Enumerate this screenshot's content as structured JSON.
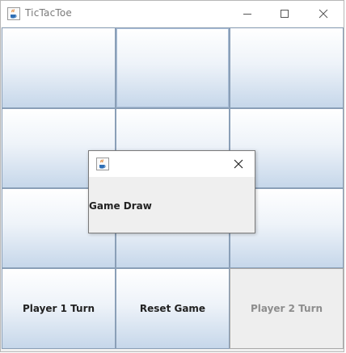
{
  "window": {
    "title": "TicTacToe",
    "icon": "java-cup-icon",
    "controls": [
      "minimize-icon",
      "maximize-icon",
      "close-icon"
    ]
  },
  "board": {
    "cells": [
      "",
      "",
      "",
      "",
      "",
      "",
      "",
      "",
      ""
    ]
  },
  "bottom_bar": {
    "player1": "Player 1 Turn",
    "reset": "Reset Game",
    "player2": "Player 2 Turn"
  },
  "dialog": {
    "title": "",
    "icon": "java-cup-icon",
    "message": "Game Draw",
    "close_icon": "close-icon"
  },
  "colors": {
    "cell_border": "#8a9fb7",
    "gradient_top": "#ffffff",
    "gradient_bottom": "#c6d7ea",
    "disabled_text": "#8d8d8d"
  }
}
